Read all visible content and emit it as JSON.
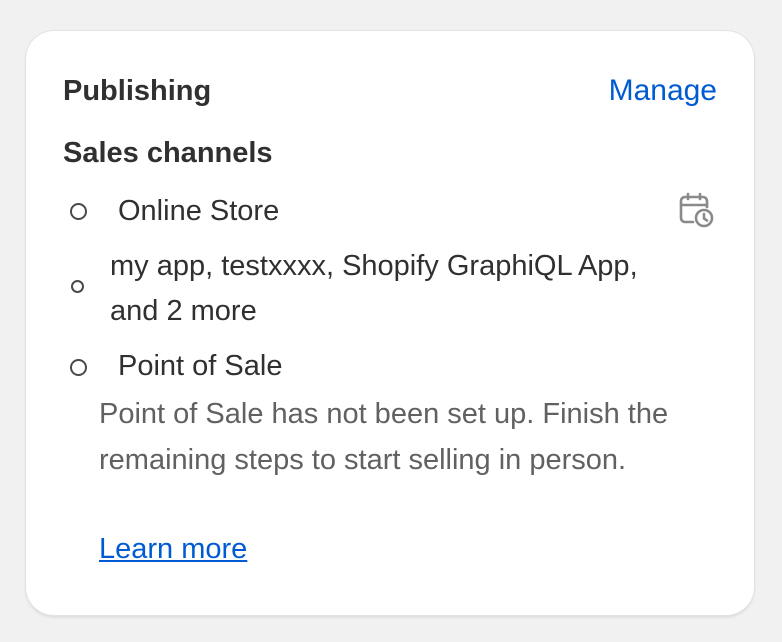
{
  "card": {
    "title": "Publishing",
    "manage_label": "Manage",
    "section_title": "Sales channels",
    "channels": [
      {
        "label": "Online Store",
        "icon": "calendar-clock-icon"
      },
      {
        "label_line1": "my app, testxxxx, Shopify GraphiQL App,",
        "label_line2": "and 2 more"
      },
      {
        "label": "Point of Sale"
      }
    ],
    "pos_description": "Point of Sale has not been set up. Finish the remaining steps to start selling in person.",
    "learn_more_label": "Learn more"
  },
  "colors": {
    "link": "#005bd3",
    "text": "#303030",
    "subdued_text": "#616161",
    "background": "#f1f1f1",
    "card": "#ffffff"
  }
}
